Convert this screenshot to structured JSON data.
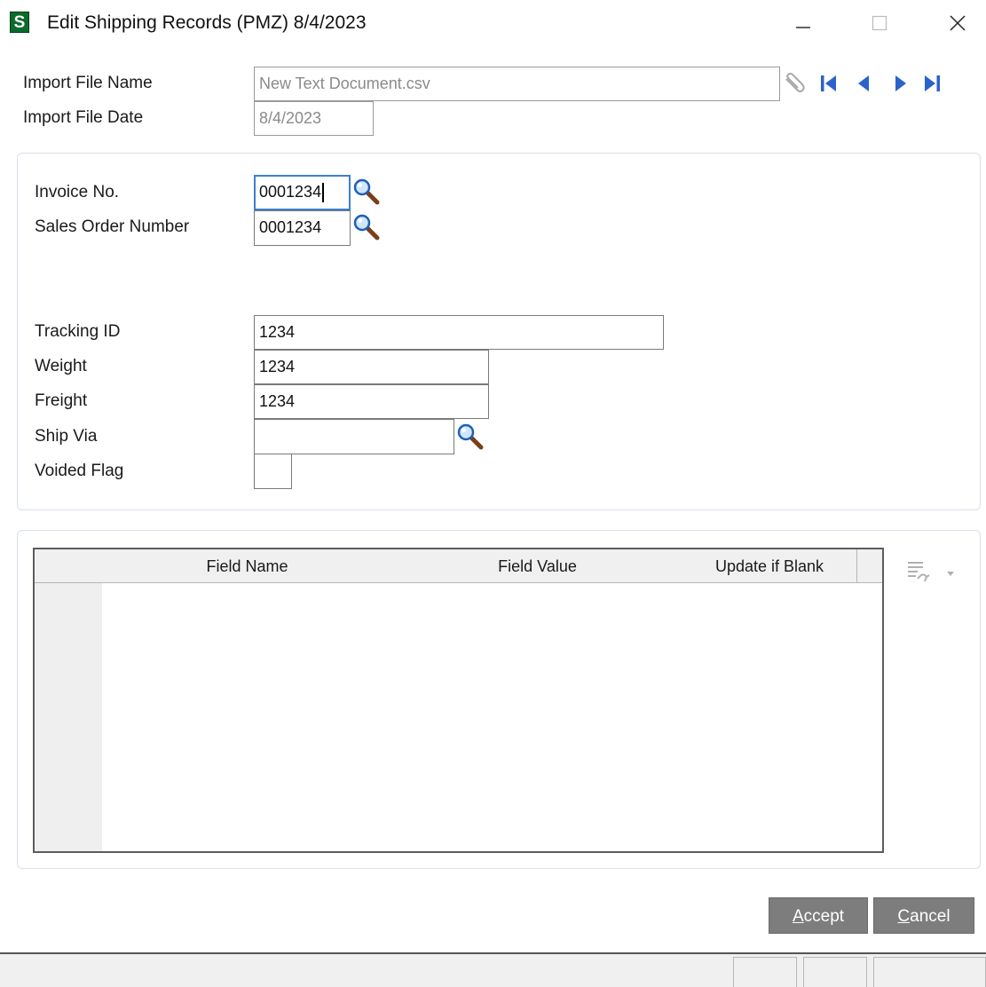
{
  "window": {
    "icon_letter": "S",
    "title": "Edit Shipping Records (PMZ) 8/4/2023"
  },
  "header": {
    "import_file_name_label": "Import File Name",
    "import_file_name_value": "New Text Document.csv",
    "import_file_date_label": "Import File Date",
    "import_file_date_value": "8/4/2023"
  },
  "form": {
    "invoice_no_label": "Invoice No.",
    "invoice_no_value": "0001234",
    "sales_order_label": "Sales Order Number",
    "sales_order_value": "0001234",
    "tracking_id_label": "Tracking ID",
    "tracking_id_value": "1234",
    "weight_label": "Weight",
    "weight_value": "1234",
    "freight_label": "Freight",
    "freight_value": "1234",
    "ship_via_label": "Ship Via",
    "ship_via_value": "",
    "voided_flag_label": "Voided Flag",
    "voided_flag_value": ""
  },
  "grid": {
    "columns": [
      "Field Name",
      "Field Value",
      "Update if Blank"
    ],
    "rows": []
  },
  "buttons": {
    "accept_pre": "",
    "accept_key": "A",
    "accept_rest": "ccept",
    "cancel_pre": "",
    "cancel_key": "C",
    "cancel_rest": "ancel"
  },
  "colors": {
    "accent": "#3c7fd1",
    "app_icon": "#0a6b2c",
    "button": "#7d7d7d",
    "nav_arrow": "#2a63c9"
  },
  "icons": {
    "lookup": "magnifier-icon",
    "attach": "paperclip-icon",
    "first": "first-record-icon",
    "prev": "previous-record-icon",
    "next": "next-record-icon",
    "last": "last-record-icon",
    "grid_tools": "grid-customize-icon"
  }
}
